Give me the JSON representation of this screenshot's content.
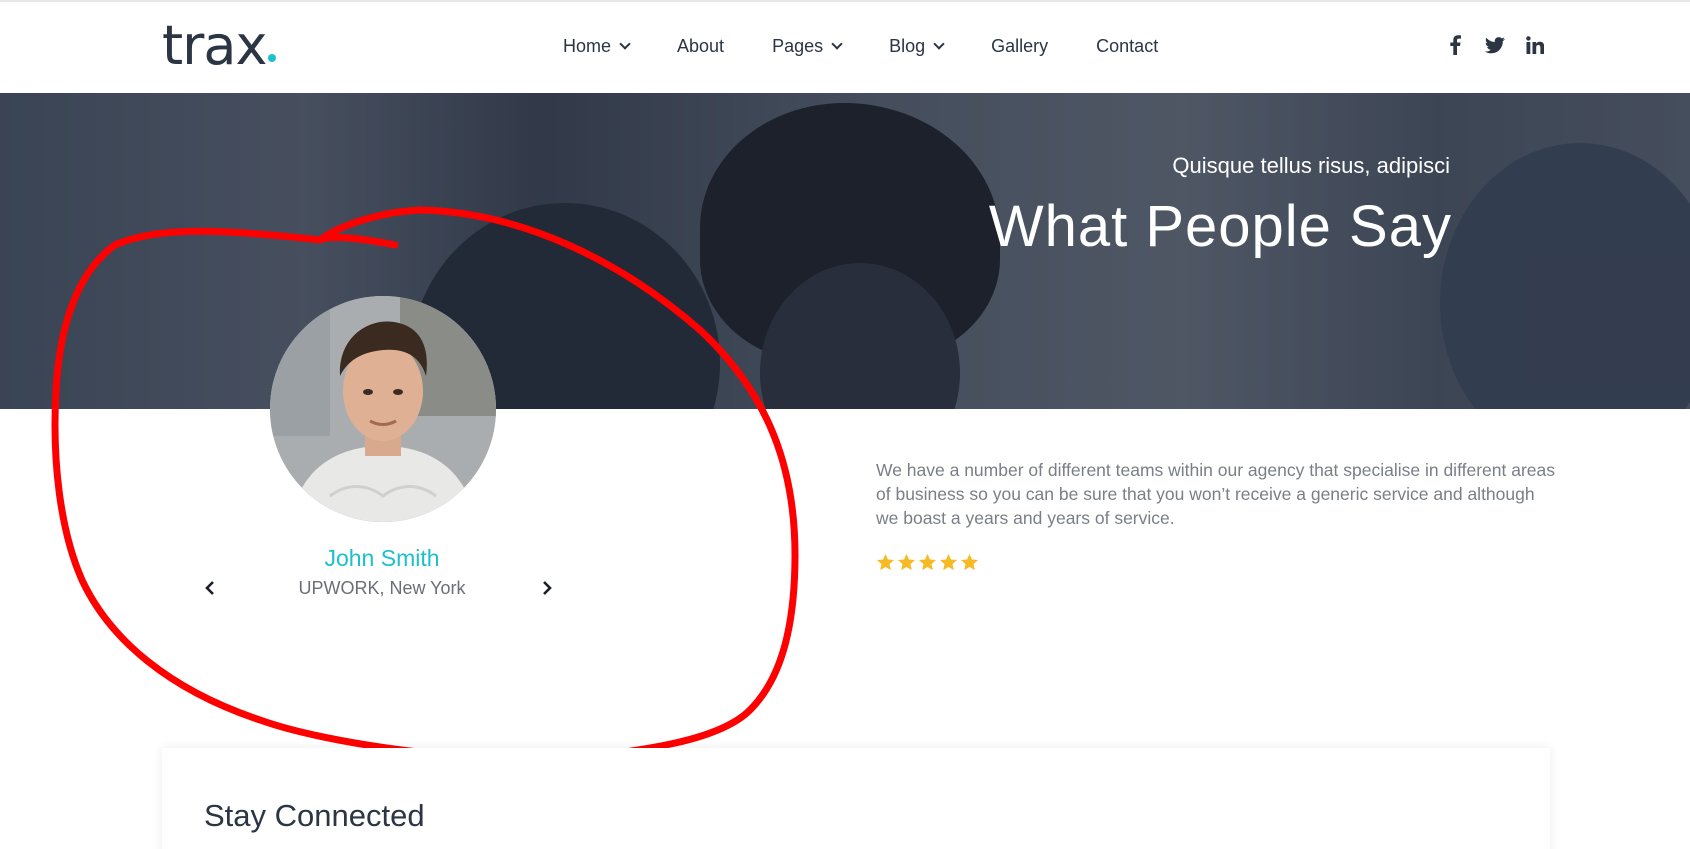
{
  "header": {
    "logo_text": "trax",
    "nav": [
      {
        "label": "Home",
        "has_dropdown": true
      },
      {
        "label": "About",
        "has_dropdown": false
      },
      {
        "label": "Pages",
        "has_dropdown": true
      },
      {
        "label": "Blog",
        "has_dropdown": true
      },
      {
        "label": "Gallery",
        "has_dropdown": false
      },
      {
        "label": "Contact",
        "has_dropdown": false
      }
    ],
    "social": [
      "facebook-icon",
      "twitter-icon",
      "linkedin-icon"
    ]
  },
  "hero": {
    "subtitle": "Quisque tellus risus, adipisci",
    "title": "What People Say"
  },
  "testimonial": {
    "name": "John Smith",
    "company": "UPWORK, New York",
    "quote": "We have a number of different teams within our agency that specialise in different areas of business so you can be sure that you won’t receive a generic service and although we boast a years and years of service.",
    "rating": 5
  },
  "stay_connected": {
    "title": "Stay Connected"
  },
  "colors": {
    "accent": "#1cc0c9",
    "text_dark": "#2b3544",
    "star": "#f7b924",
    "annotation": "#ff0000"
  }
}
